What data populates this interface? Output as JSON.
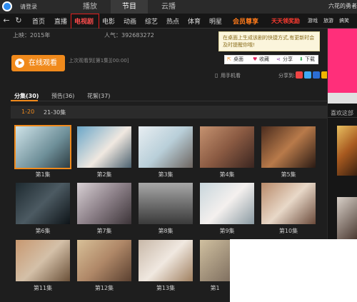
{
  "titlebar": {
    "login": "请登录",
    "tabs": [
      "播放",
      "节目",
      "云播"
    ],
    "tv_title": "六花的勇者"
  },
  "nav": {
    "items": [
      "首页",
      "直播",
      "电视剧",
      "电影",
      "动画",
      "综艺",
      "热点",
      "体育",
      "明星"
    ],
    "vip": "会员尊享",
    "promo": "天天领奖励",
    "more": [
      "游戏",
      "旅游",
      "搞笑"
    ]
  },
  "info": {
    "year": "上映：2015年",
    "popularity": "人气：392683272",
    "watch_label": "在线观看",
    "last_watched": "上次观看到[第1集][00:00]",
    "tooltip": "在桌面上生成该剧的快捷方式,有更新时会及时提醒你哦!",
    "actions": [
      "桌面",
      "收藏",
      "分享",
      "下载"
    ],
    "phone_watch": "用手机看",
    "share": "分享到:"
  },
  "subtabs": [
    "分集(30)",
    "预告(36)",
    "花絮(37)"
  ],
  "ranges": [
    "1-20",
    "21-30集"
  ],
  "episodes": [
    "第1集",
    "第2集",
    "第3集",
    "第4集",
    "第5集",
    "第6集",
    "第7集",
    "第8集",
    "第9集",
    "第10集",
    "第11集",
    "第12集",
    "第13集",
    "第1"
  ],
  "right": {
    "rec_title": "喜欢这部"
  },
  "colors": {
    "accent": "#f08a1c",
    "highlight": "#ff4d4d",
    "bg": "#1e1e1e"
  }
}
